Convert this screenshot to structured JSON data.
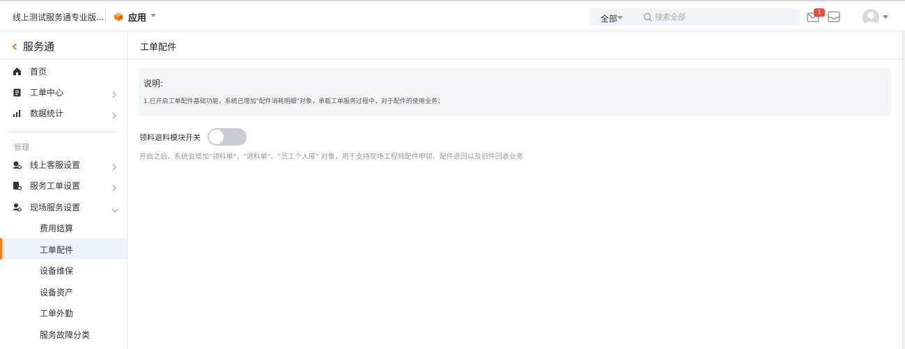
{
  "header": {
    "company": "线上测试服务通专业版...",
    "app_label": "应用",
    "search_scope": "全部",
    "search_placeholder": "搜索全部",
    "notification_count": "1",
    "brand_color": "#ff7a1a"
  },
  "sidebar": {
    "title": "服务通",
    "top_items": [
      {
        "label": "首页",
        "icon": "home-icon"
      },
      {
        "label": "工单中心",
        "icon": "clipboard-icon"
      },
      {
        "label": "数据统计",
        "icon": "bar-chart-icon"
      }
    ],
    "section_label": "管理",
    "manage_items": [
      {
        "label": "线上客服设置",
        "icon": "customer-service-icon"
      },
      {
        "label": "服务工单设置",
        "icon": "workorder-settings-icon"
      },
      {
        "label": "现场服务设置",
        "icon": "field-service-icon"
      }
    ],
    "sub_items": [
      {
        "label": "费用结算"
      },
      {
        "label": "工单配件"
      },
      {
        "label": "设备维保"
      },
      {
        "label": "设备资产"
      },
      {
        "label": "工单外勤"
      },
      {
        "label": "服务故障分类"
      }
    ],
    "active_item": "工单配件"
  },
  "main": {
    "title": "工单配件",
    "notice_title": "说明:",
    "notice_text": "1.已开启工单配件基础功能，系统已增加\"配件消耗明细\"对象，承载工单服务过程中，对于配件的使用业务；",
    "toggle_label": "领料退料模块开关",
    "toggle_on": false,
    "toggle_desc": "开启之后，系统会增加\"领料单\"、\"退料单\"、\"员工个人库\" 对象，用于支持现场工程师配件申领、配件退回以及旧件回收业务"
  }
}
